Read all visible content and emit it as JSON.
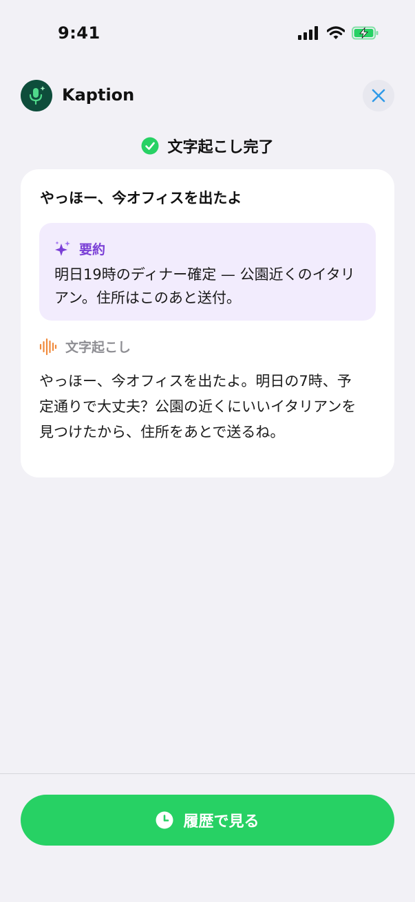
{
  "status_bar": {
    "time": "9:41"
  },
  "header": {
    "app_name": "Kaption"
  },
  "status": {
    "label": "文字起こし完了"
  },
  "message": {
    "title": "やっほー、今オフィスを出たよ",
    "summary_label": "要約",
    "summary_text": "明日19時のディナー確定 — 公園近くのイタリアン。住所はこのあと送付。",
    "transcript_label": "文字起こし",
    "transcript_text": "やっほー、今オフィスを出たよ。明日の7時、予定通りで大丈夫？公園の近くにいいイタリアンを見つけたから、住所をあとで送るね。"
  },
  "footer": {
    "history_button_label": "履歴で見る"
  },
  "colors": {
    "background": "#f2f1f6",
    "accent_green": "#27d164",
    "app_icon_bg": "#0e4d3b",
    "summary_bg": "#f2ecfd",
    "summary_accent": "#7a3fd6",
    "transcript_accent": "#f08a3c",
    "close_icon": "#2f9ae8"
  },
  "icons": [
    "signal-icon",
    "wifi-icon",
    "battery-charging-icon",
    "microphone-sparkle-icon",
    "close-icon",
    "checkmark-circle-icon",
    "sparkles-icon",
    "waveform-icon",
    "clock-icon"
  ]
}
